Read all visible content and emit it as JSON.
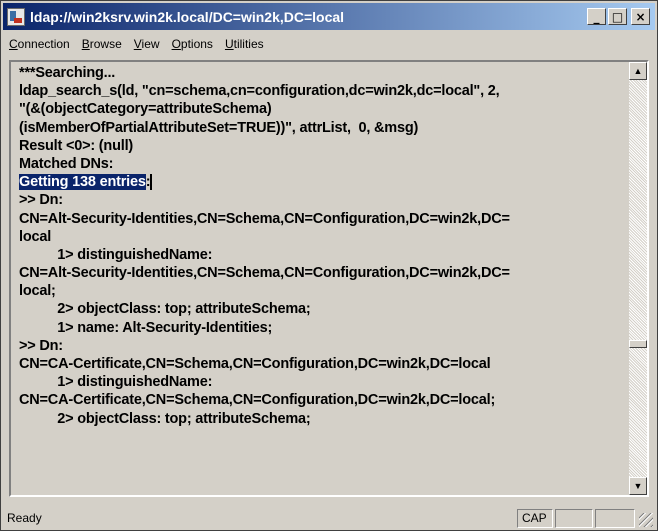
{
  "window": {
    "title": "ldap://win2ksrv.win2k.local/DC=win2k,DC=local",
    "buttons": {
      "minimize": "_",
      "maximize": "□",
      "close": "×"
    }
  },
  "menu": [
    {
      "u": "C",
      "rest": "onnection"
    },
    {
      "u": "B",
      "rest": "rowse"
    },
    {
      "u": "V",
      "rest": "iew"
    },
    {
      "u": "O",
      "rest": "ptions"
    },
    {
      "u": "U",
      "rest": "tilities"
    }
  ],
  "output": {
    "lines": [
      "***Searching...",
      "ldap_search_s(ld, \"cn=schema,cn=configuration,dc=win2k,dc=local\", 2,",
      "\"(&(objectCategory=attributeSchema)",
      "(isMemberOfPartialAttributeSet=TRUE))\", attrList,  0, &msg)",
      "Result <0>: (null)",
      "Matched DNs:",
      "__SELECTED__",
      ">> Dn:",
      "CN=Alt-Security-Identities,CN=Schema,CN=Configuration,DC=win2k,DC=",
      "local",
      "          1> distinguishedName:",
      "CN=Alt-Security-Identities,CN=Schema,CN=Configuration,DC=win2k,DC=",
      "local;",
      "          2> objectClass: top; attributeSchema;",
      "          1> name: Alt-Security-Identities;",
      ">> Dn:",
      "CN=CA-Certificate,CN=Schema,CN=Configuration,DC=win2k,DC=local",
      "          1> distinguishedName:",
      "CN=CA-Certificate,CN=Schema,CN=Configuration,DC=win2k,DC=local;",
      "          2> objectClass: top; attributeSchema;"
    ],
    "selected_text": "Getting 138 entries",
    "selected_suffix": ":"
  },
  "scrollbar": {
    "up": "▲",
    "down": "▼"
  },
  "status": {
    "text": "Ready",
    "cap": "CAP",
    "num": "",
    "scrl": ""
  }
}
